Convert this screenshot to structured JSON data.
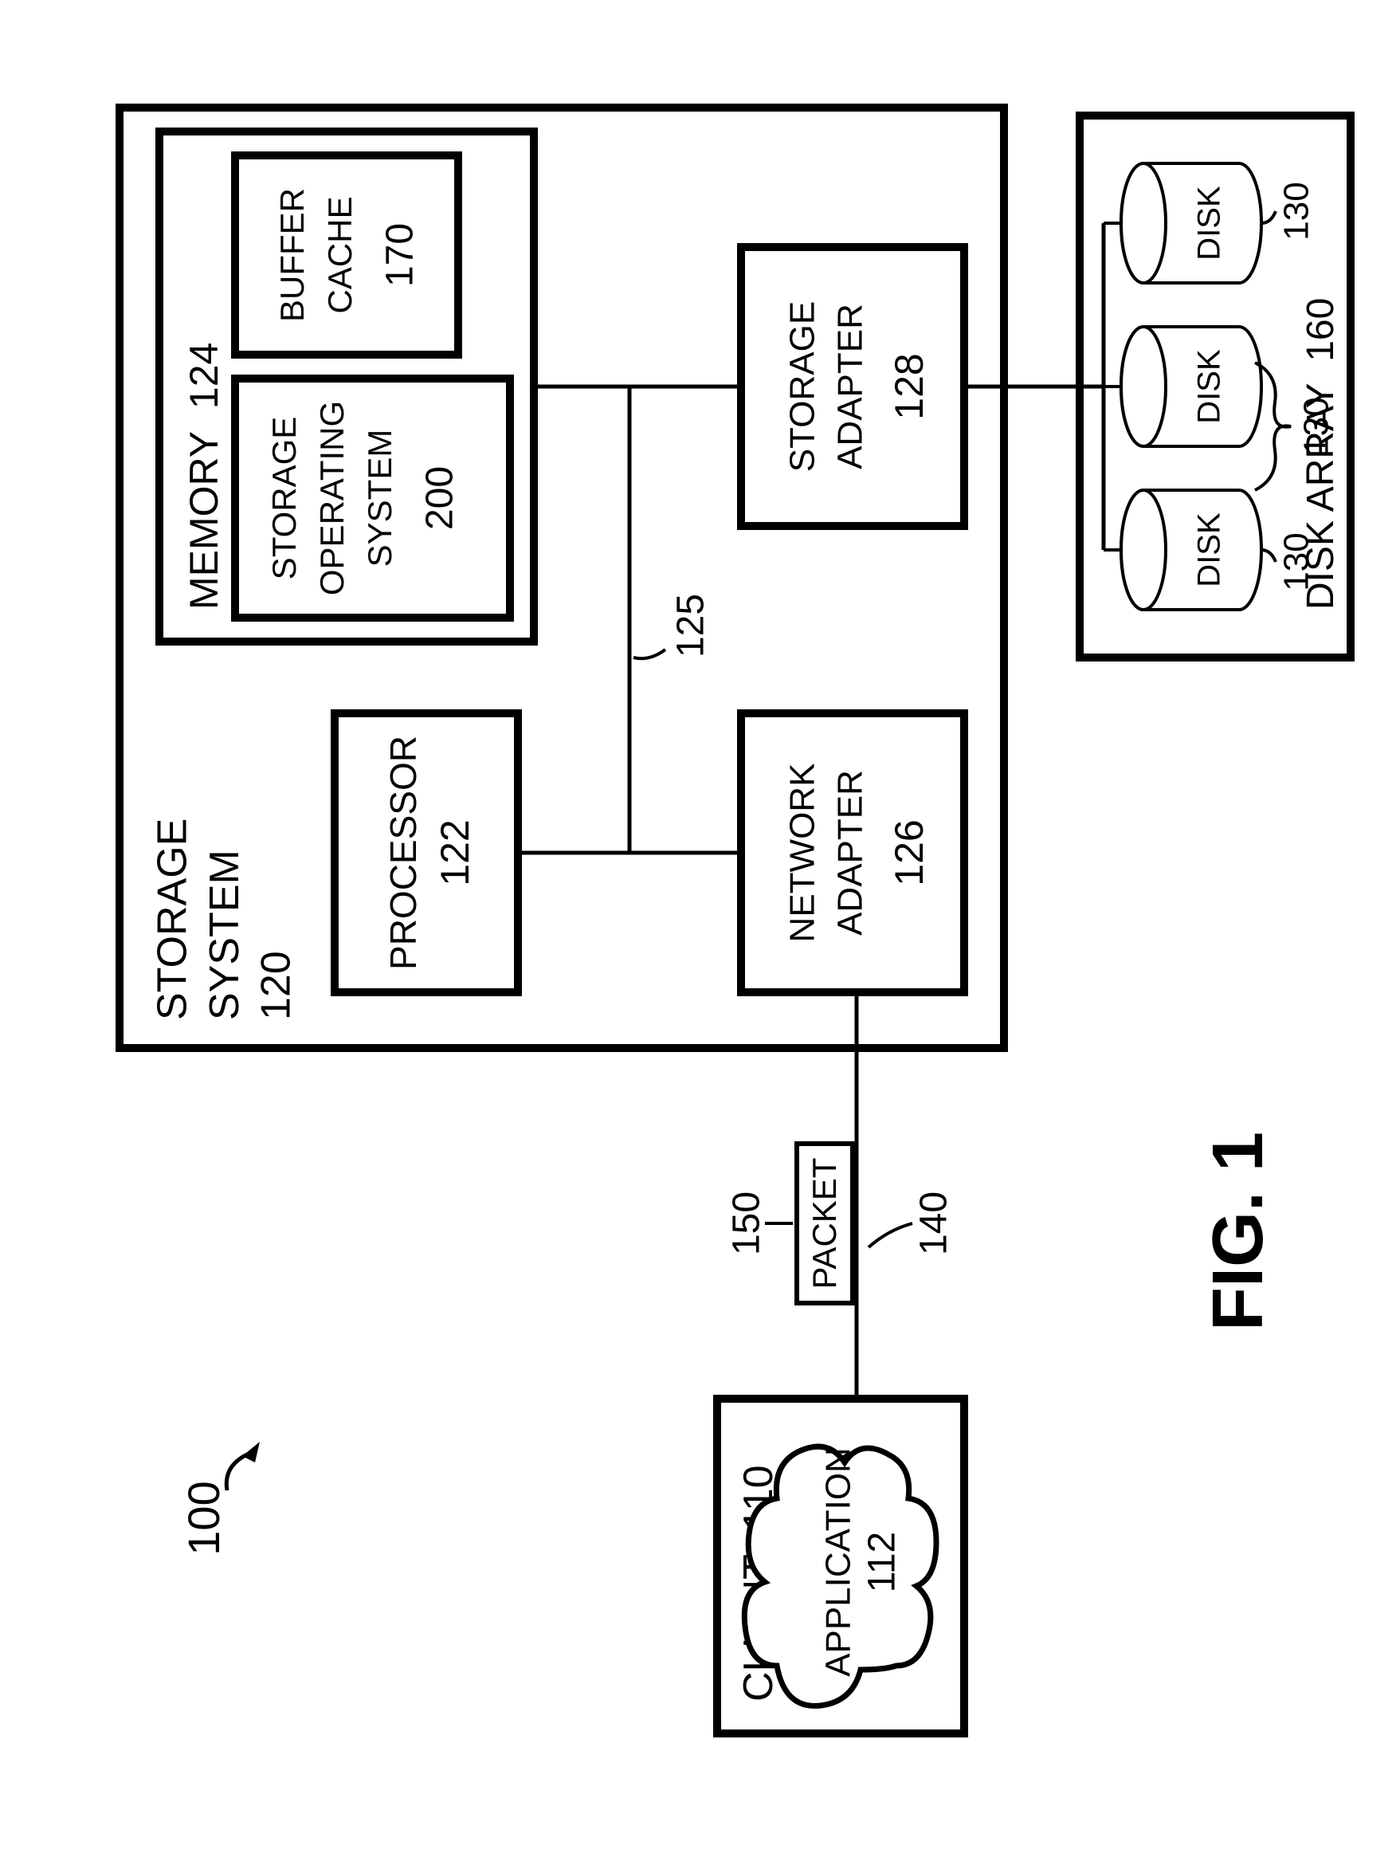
{
  "figure": {
    "ref": "100",
    "title": "FIG. 1"
  },
  "client": {
    "label": "CLIENT",
    "num": "110",
    "application": {
      "label": "APPLICATION",
      "num": "112"
    }
  },
  "link": {
    "label": "140"
  },
  "packet": {
    "label": "PACKET",
    "num": "150"
  },
  "storage_system": {
    "label": "STORAGE",
    "label2": "SYSTEM",
    "num": "120",
    "processor": {
      "label": "PROCESSOR",
      "num": "122"
    },
    "memory": {
      "label": "MEMORY",
      "num": "124",
      "storage_os": {
        "line1": "STORAGE",
        "line2": "OPERATING",
        "line3": "SYSTEM",
        "num": "200"
      },
      "buffer_cache": {
        "line1": "BUFFER",
        "line2": "CACHE",
        "num": "170"
      }
    },
    "bus": {
      "num": "125"
    },
    "network_adapter": {
      "line1": "NETWORK",
      "line2": "ADAPTER",
      "num": "126"
    },
    "storage_adapter": {
      "line1": "STORAGE",
      "line2": "ADAPTER",
      "num": "128"
    }
  },
  "disk_array": {
    "label": "DISK ARRAY",
    "num": "160",
    "disk": {
      "label": "DISK",
      "num": "130"
    }
  }
}
